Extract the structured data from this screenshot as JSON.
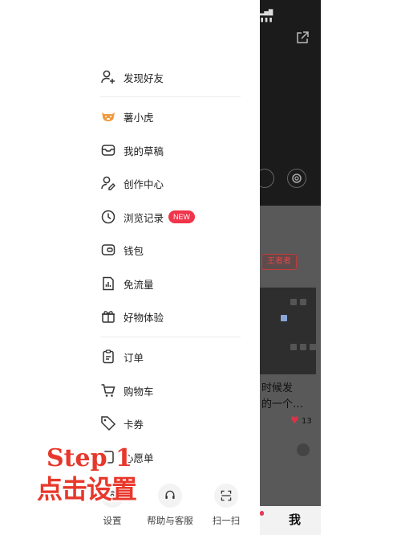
{
  "status_bar": {
    "signal": "▂▄▆",
    "battery": "▮▮▮"
  },
  "menu": {
    "discover": {
      "label": "发现好友",
      "icon": "add-user-icon"
    },
    "tiger": {
      "label": "薯小虎",
      "icon": "tiger-icon"
    },
    "drafts": {
      "label": "我的草稿",
      "icon": "inbox-icon"
    },
    "creator": {
      "label": "创作中心",
      "icon": "creator-user-icon"
    },
    "history": {
      "label": "浏览记录",
      "icon": "clock-icon",
      "badge": "NEW"
    },
    "wallet": {
      "label": "钱包",
      "icon": "wallet-icon"
    },
    "free_data": {
      "label": "免流量",
      "icon": "data-chart-icon"
    },
    "trial": {
      "label": "好物体验",
      "icon": "gift-icon"
    },
    "orders": {
      "label": "订单",
      "icon": "clipboard-icon"
    },
    "cart": {
      "label": "购物车",
      "icon": "cart-icon"
    },
    "coupons": {
      "label": "卡券",
      "icon": "ticket-icon"
    },
    "wishlist": {
      "label": "心愿单",
      "icon": "wishlist-icon"
    }
  },
  "bottom_bar": {
    "settings": "设置",
    "help": "帮助与客服",
    "scan": "扫一扫"
  },
  "background": {
    "tag": "王者者",
    "title_line1": "时候发",
    "title_line2": "的一个…",
    "likes": "13",
    "tab_me": "我"
  },
  "overlay": {
    "line1": "Step 1",
    "line2": "点击设置"
  },
  "colors": {
    "accent_red": "#f0344a",
    "overlay_red": "#e8372b",
    "tiger_orange": "#f19a3e"
  }
}
